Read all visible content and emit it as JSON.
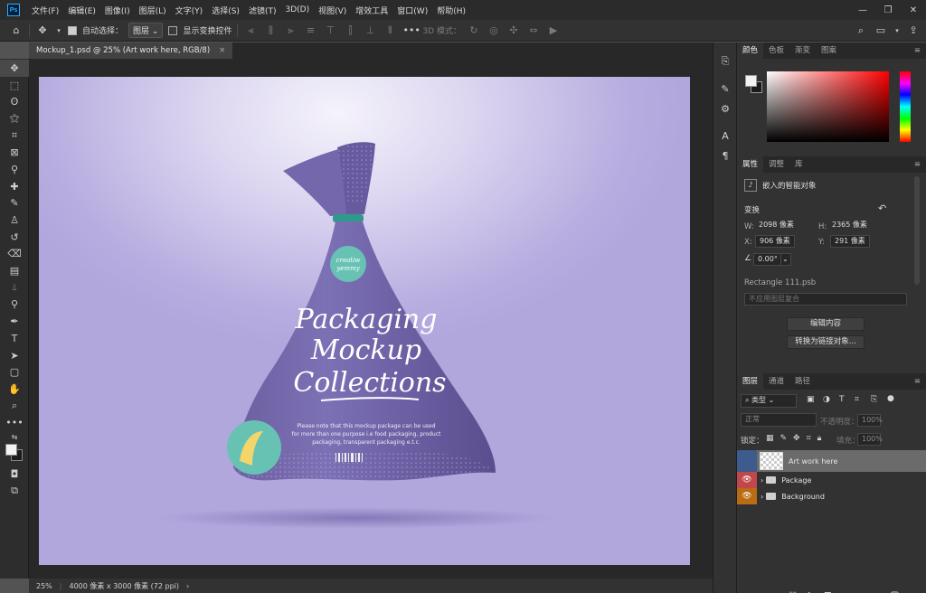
{
  "app": {
    "logo": "Ps"
  },
  "menubar": {
    "items": [
      "文件(F)",
      "编辑(E)",
      "图像(I)",
      "图层(L)",
      "文字(Y)",
      "选择(S)",
      "滤镜(T)",
      "3D(D)",
      "视图(V)",
      "增效工具",
      "窗口(W)",
      "帮助(H)"
    ]
  },
  "options": {
    "auto_select_label": "自动选择：",
    "auto_select_target": "图层",
    "show_transform_label": "显示变换控件",
    "mode3d_label": "3D 模式："
  },
  "document": {
    "tab_title": "Mockup_1.psd @ 25% (Art work here, RGB/8)",
    "zoom": "25%",
    "size_info": "4000 像素 x 3000 像素 (72 ppi)"
  },
  "artwork": {
    "badge_line1": "creatiw",
    "badge_line2": "yemmy",
    "title_line1": "Packaging",
    "title_line2": "Mockup",
    "title_line3": "Collections",
    "note_line1": "Please note that this mockup package can be used",
    "note_line2": "for more than one purpose i.e food packaging, product",
    "note_line3": "packaging, transparent packaging e.t.c."
  },
  "color_panel": {
    "tabs": [
      "颜色",
      "色板",
      "渐变",
      "图案"
    ],
    "foreground": "#f2f2f2",
    "background": "#1b1b1b",
    "hue": "#ff0000"
  },
  "properties": {
    "tabs": [
      "属性",
      "调整",
      "库"
    ],
    "type_label": "嵌入的智能对象",
    "transform_label": "变换",
    "w_label": "W:",
    "w_value": "2098 像素",
    "h_label": "H:",
    "h_value": "2365 像素",
    "x_label": "X:",
    "x_value": "906 像素",
    "y_label": "Y:",
    "y_value": "291 像素",
    "angle_value": "0.00°",
    "file_name": "Rectangle 111.psb",
    "comp_placeholder": "不应用图层复合",
    "edit_button": "编辑内容",
    "convert_button": "转换为链接对象..."
  },
  "layers": {
    "tabs": [
      "图层",
      "通道",
      "路径"
    ],
    "filter_label": "类型",
    "blend_mode": "正常",
    "opacity_label": "不透明度：",
    "opacity_value": "100%",
    "lock_label": "锁定：",
    "fill_label": "填充：",
    "fill_value": "100%",
    "items": [
      {
        "name": "Art work here",
        "type": "smart-object",
        "selected": true
      },
      {
        "name": "Package",
        "type": "group",
        "color": "#c0474a"
      },
      {
        "name": "Background",
        "type": "group",
        "color": "#b96c12"
      }
    ]
  }
}
